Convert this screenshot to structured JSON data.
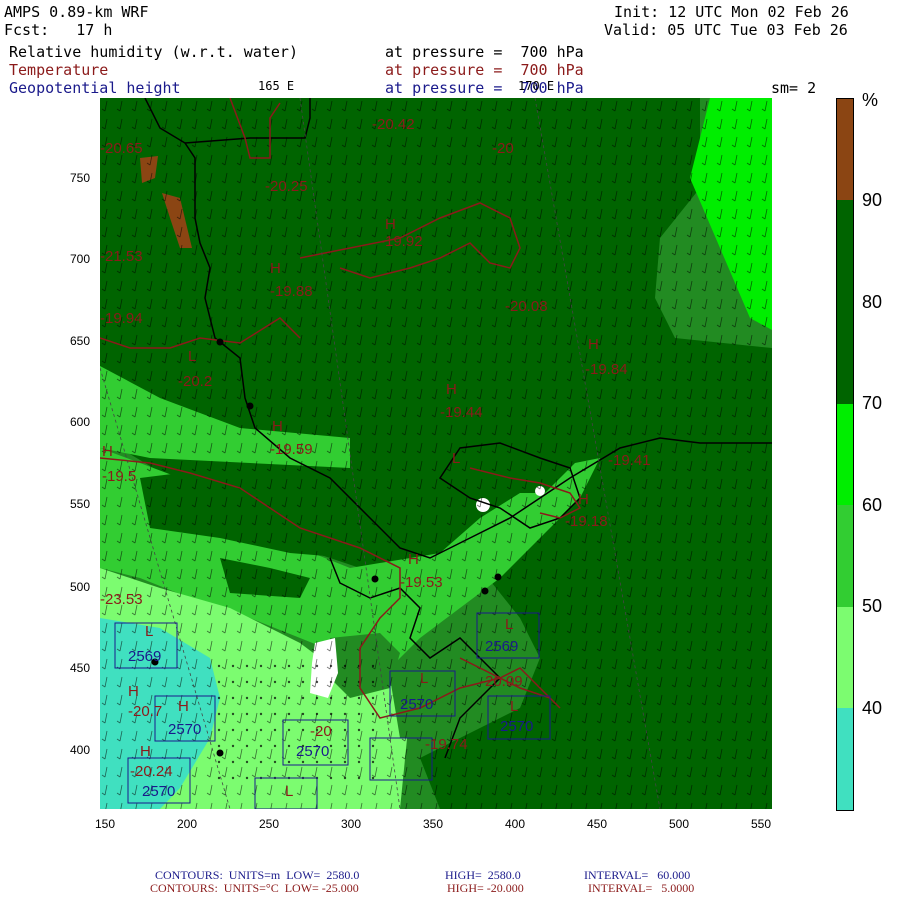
{
  "header": {
    "model": "AMPS 0.89-km WRF",
    "fcst": "Fcst:   17 h",
    "init": "Init: 12 UTC Mon 02 Feb 26",
    "valid": "Valid: 05 UTC Tue 03 Feb 26",
    "field1": "Relative humidity (w.r.t. water)",
    "field1_level": "at pressure =  700 hPa",
    "field2": "Temperature",
    "field2_level": "at pressure =  700 hPa",
    "field3": "Geopotential height",
    "field3_level": "at pressure =  700 hPa",
    "lon_165": "165 E",
    "lon_170": "170 E",
    "sm": "sm= 2"
  },
  "axes": {
    "x_ticks": [
      "150",
      "200",
      "250",
      "300",
      "350",
      "400",
      "450",
      "500",
      "550"
    ],
    "y_ticks": [
      "750",
      "700",
      "650",
      "600",
      "550",
      "500",
      "450",
      "400"
    ]
  },
  "colorbar": {
    "unit": "%",
    "labels": [
      "90",
      "80",
      "70",
      "60",
      "50",
      "40"
    ],
    "colors": [
      "#8b4513",
      "#006400",
      "#228b22",
      "#00ee00",
      "#32cd32",
      "#7cfc70",
      "#40e0c0"
    ]
  },
  "map_labels": {
    "temps": [
      "-20.65",
      "-20.42",
      "-20.25",
      "-20",
      "-19.92",
      "-19.88",
      "-20.08",
      "-21.53",
      "-19.94",
      "-20.2",
      "-19.84",
      "-19.44",
      "-19.59",
      "-19.41",
      "-19.5",
      "-19.18",
      "-19.53",
      "-23.53",
      "-20.7",
      "-20.24",
      "-20",
      "-19.74",
      "-20.09"
    ],
    "highs": [
      "H",
      "H",
      "H",
      "H",
      "H",
      "H",
      "H",
      "H",
      "H",
      "H",
      "H"
    ],
    "lows": [
      "L",
      "L",
      "L",
      "L",
      "L",
      "L",
      "L"
    ],
    "heights": [
      "2569",
      "2570",
      "2570",
      "2570",
      "2569",
      "2570",
      "2570"
    ]
  },
  "footer": {
    "line1_a": "CONTOURS:  UNITS=m  LOW=  2580.0",
    "line1_b": "HIGH=  2580.0",
    "line1_c": "INTERVAL=   60.000",
    "line2_a": "CONTOURS:  UNITS=°C  LOW= -25.000",
    "line2_b": "HIGH= -20.000",
    "line2_c": "INTERVAL=   5.0000"
  }
}
